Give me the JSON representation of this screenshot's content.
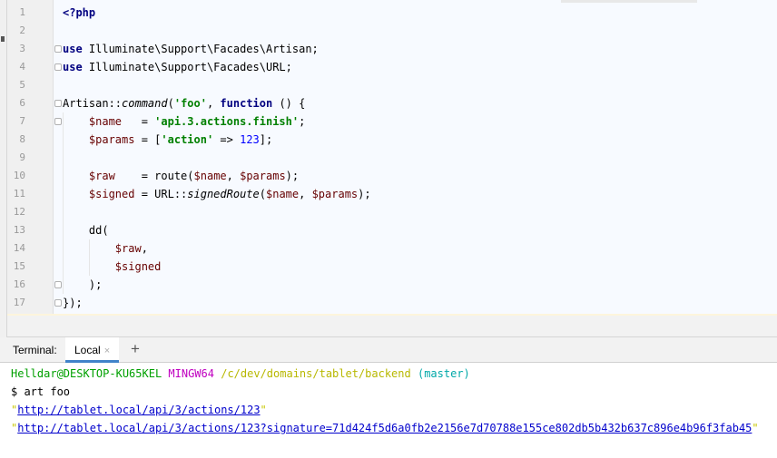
{
  "editor": {
    "lines": [
      {
        "n": "1",
        "parts": [
          {
            "c": "kw",
            "t": "<?php"
          }
        ]
      },
      {
        "n": "2",
        "parts": []
      },
      {
        "n": "3",
        "parts": [
          {
            "c": "kw",
            "t": "use"
          },
          {
            "c": "",
            "t": " Illuminate\\Support\\Facades\\Artisan;"
          }
        ]
      },
      {
        "n": "4",
        "parts": [
          {
            "c": "kw",
            "t": "use"
          },
          {
            "c": "",
            "t": " Illuminate\\Support\\Facades\\URL;"
          }
        ]
      },
      {
        "n": "5",
        "parts": []
      },
      {
        "n": "6",
        "parts": [
          {
            "c": "",
            "t": "Artisan::"
          },
          {
            "c": "fn-italic",
            "t": "command"
          },
          {
            "c": "",
            "t": "("
          },
          {
            "c": "str",
            "t": "'foo'"
          },
          {
            "c": "",
            "t": ", "
          },
          {
            "c": "kw",
            "t": "function"
          },
          {
            "c": "",
            "t": " () {"
          }
        ]
      },
      {
        "n": "7",
        "parts": [
          {
            "c": "",
            "t": "    "
          },
          {
            "c": "var",
            "t": "$name"
          },
          {
            "c": "",
            "t": "   = "
          },
          {
            "c": "str",
            "t": "'api.3.actions.finish'"
          },
          {
            "c": "",
            "t": ";"
          }
        ]
      },
      {
        "n": "8",
        "parts": [
          {
            "c": "",
            "t": "    "
          },
          {
            "c": "var",
            "t": "$params"
          },
          {
            "c": "",
            "t": " = ["
          },
          {
            "c": "str",
            "t": "'action'"
          },
          {
            "c": "",
            "t": " => "
          },
          {
            "c": "num",
            "t": "123"
          },
          {
            "c": "",
            "t": "];"
          }
        ]
      },
      {
        "n": "9",
        "parts": []
      },
      {
        "n": "10",
        "parts": [
          {
            "c": "",
            "t": "    "
          },
          {
            "c": "var",
            "t": "$raw"
          },
          {
            "c": "",
            "t": "    = route("
          },
          {
            "c": "var",
            "t": "$name"
          },
          {
            "c": "",
            "t": ", "
          },
          {
            "c": "var",
            "t": "$params"
          },
          {
            "c": "",
            "t": ");"
          }
        ]
      },
      {
        "n": "11",
        "parts": [
          {
            "c": "",
            "t": "    "
          },
          {
            "c": "var",
            "t": "$signed"
          },
          {
            "c": "",
            "t": " = URL::"
          },
          {
            "c": "fn-italic",
            "t": "signedRoute"
          },
          {
            "c": "",
            "t": "("
          },
          {
            "c": "var",
            "t": "$name"
          },
          {
            "c": "",
            "t": ", "
          },
          {
            "c": "var",
            "t": "$params"
          },
          {
            "c": "",
            "t": ");"
          }
        ]
      },
      {
        "n": "12",
        "parts": []
      },
      {
        "n": "13",
        "parts": [
          {
            "c": "",
            "t": "    dd("
          }
        ]
      },
      {
        "n": "14",
        "parts": [
          {
            "c": "",
            "t": "        "
          },
          {
            "c": "var",
            "t": "$raw"
          },
          {
            "c": "",
            "t": ","
          }
        ]
      },
      {
        "n": "15",
        "parts": [
          {
            "c": "",
            "t": "        "
          },
          {
            "c": "var",
            "t": "$signed"
          }
        ]
      },
      {
        "n": "16",
        "parts": [
          {
            "c": "",
            "t": "    );"
          }
        ]
      },
      {
        "n": "17",
        "parts": [
          {
            "c": "",
            "t": "});"
          }
        ]
      }
    ]
  },
  "terminal": {
    "title": "Terminal:",
    "tab_label": "Local",
    "tab_close": "×",
    "add_label": "+",
    "prompt": {
      "user": "Helldar@DESKTOP-KU65KEL",
      "system": "MINGW64",
      "path": "/c/dev/domains/tablet/backend",
      "branch": "(master)"
    },
    "command": "$ art foo",
    "output": [
      "http://tablet.local/api/3/actions/123",
      "http://tablet.local/api/3/actions/123?signature=71d424f5d6a0fb2e2156e7d70788e155ce802db5b432b637c896e4b96f3fab45"
    ],
    "quote": "\""
  },
  "colors": {
    "accent": "#4083c9",
    "editor_bg": "#f7faff",
    "keyword": "#000080",
    "string": "#008000",
    "variable": "#660000"
  }
}
